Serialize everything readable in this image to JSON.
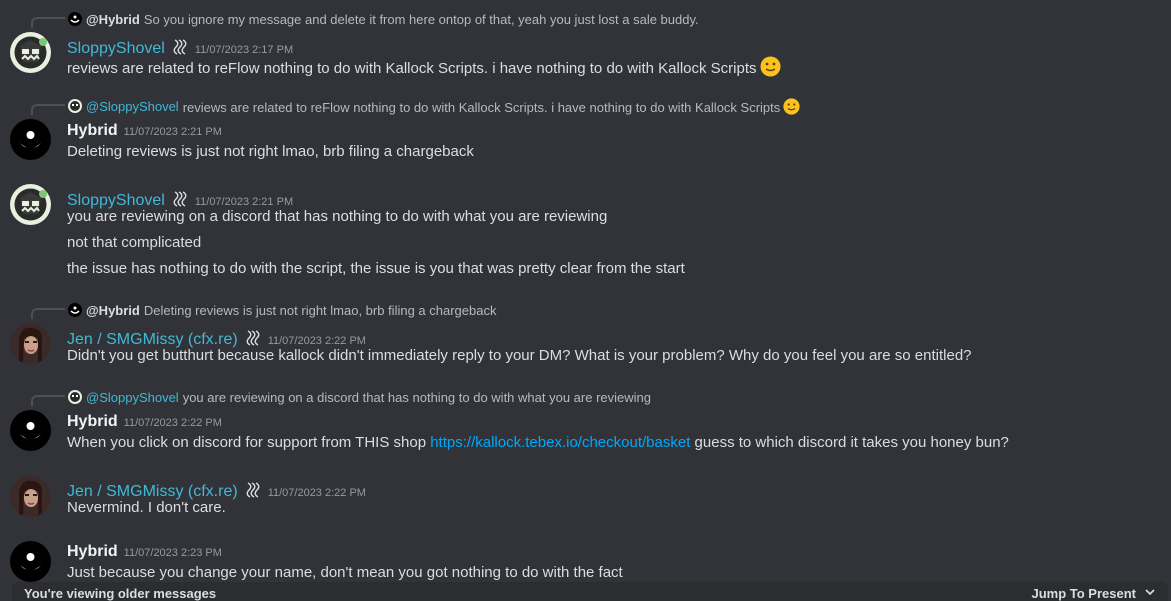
{
  "messages": [
    {
      "reply": {
        "name": "@Hybrid",
        "text": "So you ignore my message and delete it from here ontop of that, yeah you just lost a sale buddy."
      },
      "author": "SloppyShovel",
      "timestamp": "11/07/2023 2:17 PM",
      "lines": [
        "reviews are related to reFlow nothing to do with Kallock Scripts. i have nothing to do with Kallock Scripts"
      ]
    },
    {
      "reply": {
        "name": "@SloppyShovel",
        "text": "reviews are related to reFlow nothing to do with Kallock Scripts. i have nothing to do with Kallock Scripts"
      },
      "author": "Hybrid",
      "timestamp": "11/07/2023 2:21 PM",
      "lines": [
        "Deleting reviews is just not right lmao, brb filing a chargeback"
      ]
    },
    {
      "author": "SloppyShovel",
      "timestamp": "11/07/2023 2:21 PM",
      "lines": [
        "you are reviewing on a discord that has nothing to do with what you are reviewing",
        "not that complicated",
        "the issue has nothing to do with the script, the issue is you that was pretty clear from the start"
      ]
    },
    {
      "reply": {
        "name": "@Hybrid",
        "text": "Deleting reviews is just not right lmao, brb filing a chargeback"
      },
      "author": "Jen / SMGMissy (cfx.re)",
      "timestamp": "11/07/2023 2:22 PM",
      "lines": [
        "Didn't you get butthurt because kallock didn't immediately reply to your DM? What is your problem? Why do you feel you are so entitled?"
      ]
    },
    {
      "reply": {
        "name": "@SloppyShovel",
        "text": "you are reviewing on a discord that has nothing to do with what you are reviewing"
      },
      "author": "Hybrid",
      "timestamp": "11/07/2023 2:22 PM",
      "line_pre": "When you click on discord for support from THIS shop ",
      "link": "https://kallock.tebex.io/checkout/basket",
      "line_post": " guess to which discord it takes you honey bun?"
    },
    {
      "author": "Jen / SMGMissy (cfx.re)",
      "timestamp": "11/07/2023 2:22 PM",
      "lines": [
        "Nevermind. I don't care."
      ]
    },
    {
      "author": "Hybrid",
      "timestamp": "11/07/2023 2:23 PM",
      "lines": [
        "Just because you change your name, don't mean you got nothing to do with the fact"
      ]
    }
  ],
  "older_bar": {
    "text": "You're viewing older messages",
    "jump": "Jump To Present"
  },
  "colors": {
    "background": "#313338",
    "teal_username": "#41b8d6",
    "link": "#00a8fc",
    "bar": "#2b2d31"
  }
}
